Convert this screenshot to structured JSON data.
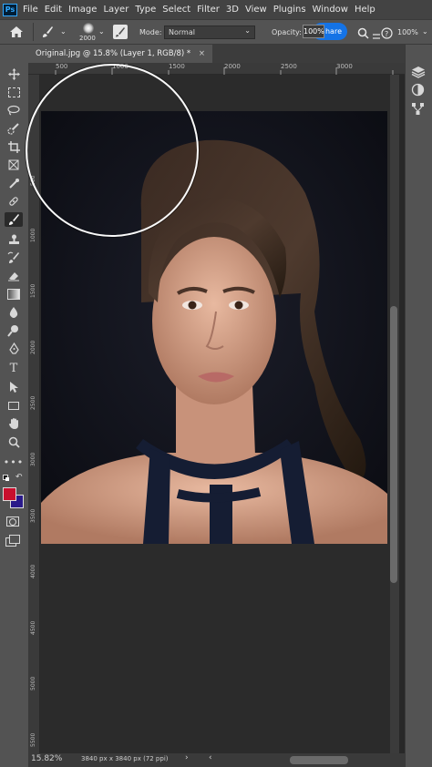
{
  "menubar": {
    "logo": "Ps",
    "items": [
      "File",
      "Edit",
      "Image",
      "Layer",
      "Type",
      "Select",
      "Filter",
      "3D",
      "View",
      "Plugins",
      "Window",
      "Help"
    ]
  },
  "options": {
    "brush_size": "2000",
    "mode_label": "Mode:",
    "mode_value": "Normal",
    "opacity_label": "Opacity:",
    "opacity_value": "100%",
    "share_label": "hare",
    "zoom_value": "100%"
  },
  "document": {
    "tab_title": "Original.jpg @ 15.8% (Layer 1, RGB/8) *",
    "close_glyph": "×"
  },
  "rulers": {
    "top": [
      "500",
      "1000",
      "1500",
      "2000",
      "2500",
      "3000"
    ],
    "left": [
      "500",
      "1000",
      "1500",
      "2000",
      "2500",
      "3000",
      "3500",
      "4000",
      "4500",
      "5000",
      "5500"
    ]
  },
  "status": {
    "zoom": "15.82%",
    "doc_info": "3840 px x 3840 px (72 ppi)"
  },
  "colors": {
    "foreground": "#c8102e",
    "background": "#2a1a8a",
    "accent": "#1473e6"
  },
  "icons": {
    "toolbar": [
      "move-icon",
      "marquee-icon",
      "lasso-icon",
      "quick-select-icon",
      "crop-icon",
      "frame-icon",
      "eyedropper-icon",
      "healing-icon",
      "brush-icon",
      "stamp-icon",
      "history-brush-icon",
      "eraser-icon",
      "gradient-icon",
      "blur-icon",
      "dodge-icon",
      "pen-icon",
      "type-icon",
      "path-select-icon",
      "rectangle-icon",
      "hand-icon",
      "zoom-icon",
      "more-icon"
    ]
  }
}
